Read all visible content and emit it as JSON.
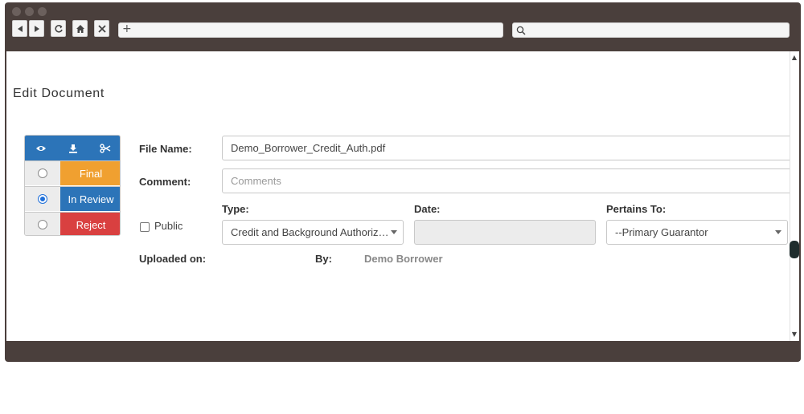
{
  "browser": {
    "address_prefix": "+"
  },
  "page": {
    "title": "Edit Document"
  },
  "status": {
    "options": [
      {
        "label": "Final",
        "selected": false,
        "color": "#f0a030"
      },
      {
        "label": "In Review",
        "selected": true,
        "color": "#2c74b8"
      },
      {
        "label": "Reject",
        "selected": false,
        "color": "#d94040"
      }
    ],
    "action_icons": [
      "eye-icon",
      "download-icon",
      "scissors-icon"
    ]
  },
  "form": {
    "file_name_label": "File Name:",
    "file_name_value": "Demo_Borrower_Credit_Auth.pdf",
    "comment_label": "Comment:",
    "comment_placeholder": "Comments",
    "public_label": "Public",
    "public_checked": false,
    "type_label": "Type:",
    "type_value": "Credit and Background Authoriz…",
    "date_label": "Date:",
    "date_value": "",
    "pertains_label": "Pertains To:",
    "pertains_value": "--Primary Guarantor",
    "uploaded_label": "Uploaded on:",
    "uploaded_value": "",
    "by_label": "By:",
    "by_value": "Demo Borrower"
  }
}
